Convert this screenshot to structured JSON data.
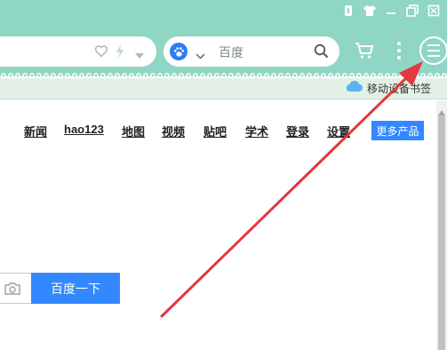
{
  "window": {
    "controls": [
      {
        "icon": "skin-icon"
      },
      {
        "icon": "shirt-icon"
      },
      {
        "icon": "minimize-icon"
      },
      {
        "icon": "restore-icon"
      },
      {
        "icon": "close-icon"
      }
    ]
  },
  "toolbar": {
    "search": {
      "placeholder": "百度",
      "engine_icon": "baidu-paw-icon"
    },
    "menu_icon": "hamburger-menu-icon"
  },
  "bookmarks": {
    "mobile_label": "移动设备书签"
  },
  "page": {
    "nav": [
      {
        "label": "新闻"
      },
      {
        "label": "hao123"
      },
      {
        "label": "地图"
      },
      {
        "label": "视频"
      },
      {
        "label": "贴吧"
      },
      {
        "label": "学术"
      },
      {
        "label": "登录"
      },
      {
        "label": "设置"
      }
    ],
    "more_products": "更多产品",
    "search_button": "百度一下"
  },
  "colors": {
    "chrome": "#8fd6c4",
    "bookmark_bar": "#e3f0e5",
    "accent_blue": "#3388ff",
    "annotation_arrow": "#e0393e"
  }
}
